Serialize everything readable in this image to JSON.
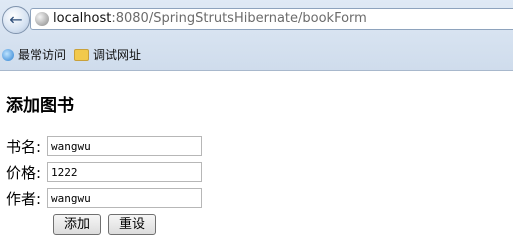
{
  "browser": {
    "url_host": "localhost",
    "url_rest": ":8080/SpringStrutsHibernate/bookForm",
    "back_icon": "back-arrow-icon",
    "bookmarks": [
      {
        "label": "最常访问",
        "icon": "ie-icon"
      },
      {
        "label": "调试网址",
        "icon": "folder-icon"
      }
    ]
  },
  "form": {
    "title": "添加图书",
    "fields": [
      {
        "label": "书名:",
        "value": "wangwu"
      },
      {
        "label": "价格:",
        "value": "1222"
      },
      {
        "label": "作者:",
        "value": "wangwu"
      }
    ],
    "submit_label": "添加",
    "reset_label": "重设"
  }
}
